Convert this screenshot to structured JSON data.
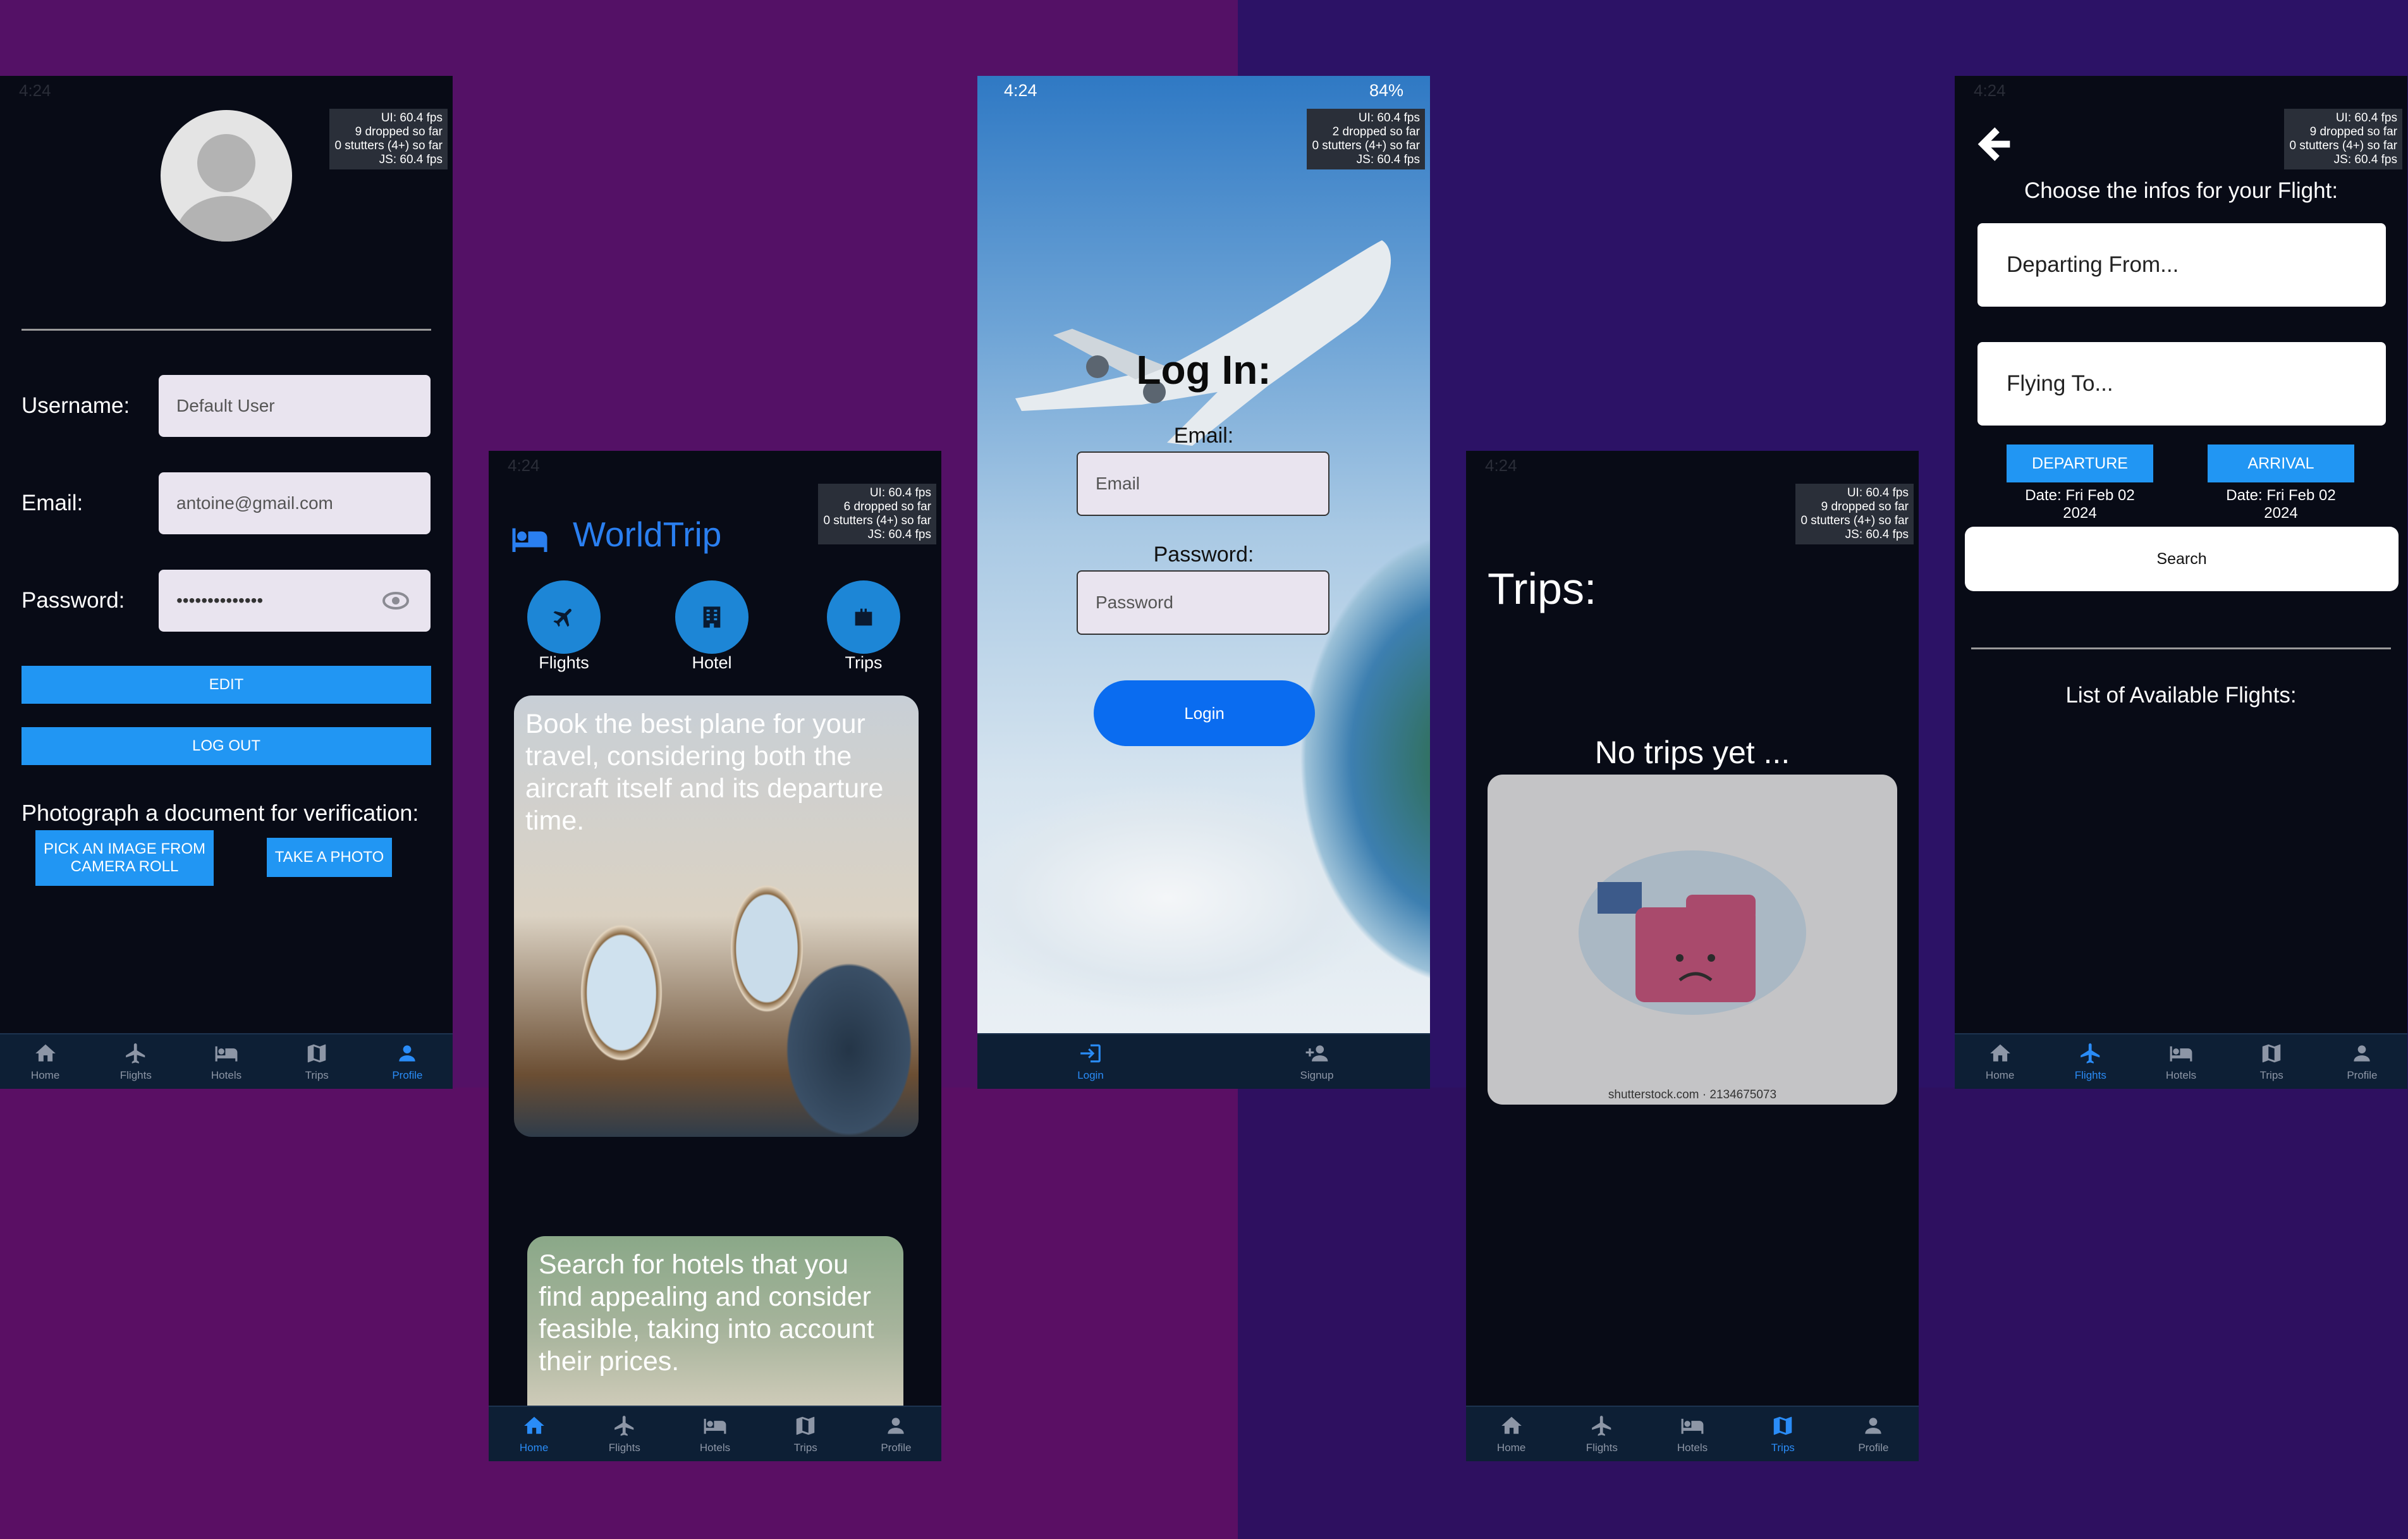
{
  "fps_overlay": {
    "profile": "UI: 60.4 fps\n9 dropped so far\n0 stutters (4+) so far\nJS: 60.4 fps",
    "home": "UI: 60.4 fps\n6 dropped so far\n0 stutters (4+) so far\nJS: 60.4 fps",
    "login": "UI: 60.4 fps\n2 dropped so far\n0 stutters (4+) so far\nJS: 60.4 fps",
    "trips": "UI: 60.4 fps\n9 dropped so far\n0 stutters (4+) so far\nJS: 60.4 fps",
    "flights": "UI: 60.4 fps\n9 dropped so far\n0 stutters (4+) so far\nJS: 60.4 fps"
  },
  "tabs": {
    "home": "Home",
    "flights": "Flights",
    "hotels": "Hotels",
    "trips": "Trips",
    "profile": "Profile"
  },
  "profile_screen": {
    "username_label": "Username:",
    "username_value": "Default User",
    "email_label": "Email:",
    "email_value": "antoine@gmail.com",
    "password_label": "Password:",
    "password_value": "••••••••••••••",
    "edit_button": "EDIT",
    "logout_button": "LOG OUT",
    "verification_text": "Photograph a document for verification:",
    "pick_image_button": "PICK AN IMAGE FROM CAMERA ROLL",
    "take_photo_button": "TAKE A PHOTO"
  },
  "home_screen": {
    "app_title": "WorldTrip",
    "categories": [
      {
        "label": "Flights",
        "icon": "plane-icon"
      },
      {
        "label": "Hotel",
        "icon": "building-icon"
      },
      {
        "label": "Trips",
        "icon": "suitcase-icon"
      }
    ],
    "card_1_text": "Book the best plane for your travel, considering both the aircraft itself and its departure time.",
    "card_2_text": "Search for hotels that you find appealing and consider feasible, taking into account their prices."
  },
  "login_screen": {
    "status_time": "4:24",
    "status_battery": "84%",
    "title": "Log In:",
    "email_label": "Email:",
    "email_placeholder": "Email",
    "password_label": "Password:",
    "password_placeholder": "Password",
    "login_button": "Login",
    "tab_login": "Login",
    "tab_signup": "Signup"
  },
  "trips_screen": {
    "title": "Trips:",
    "empty_text": "No trips yet ...",
    "image_caption": "shutterstock.com · 2134675073"
  },
  "flights_screen": {
    "heading": "Choose the infos for your Flight:",
    "departing_placeholder": "Departing From...",
    "flying_to_placeholder": "Flying To...",
    "departure_button": "DEPARTURE",
    "arrival_button": "ARRIVAL",
    "departure_date": "Date: Fri Feb 02 2024",
    "arrival_date": "Date: Fri Feb 02 2024",
    "search_button": "Search",
    "list_title": "List of Available Flights:"
  },
  "colors": {
    "accent_blue": "#2196f3",
    "login_blue": "#0a6cf0",
    "tab_active": "#2a8cf7"
  }
}
